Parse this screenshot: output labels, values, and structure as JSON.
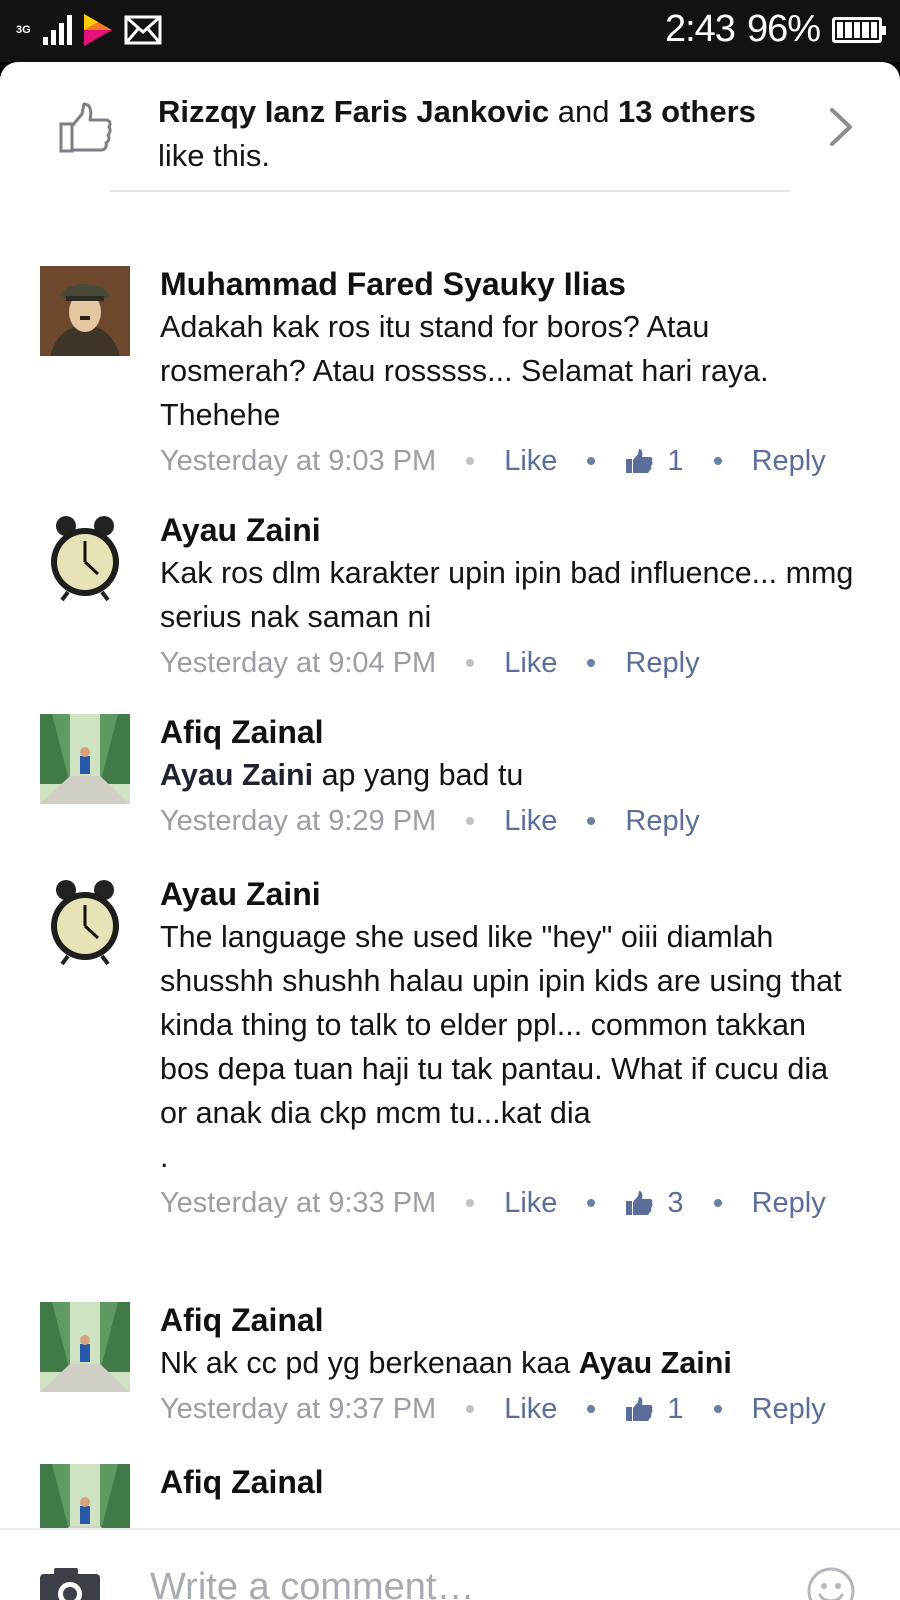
{
  "status_bar": {
    "network": "3G",
    "time": "2:43",
    "battery_percent": "96%"
  },
  "likes_summary": {
    "first_name": "Rizzqy Ianz Faris Jankovic",
    "joiner": " and ",
    "others_count": "13",
    "others_word": "others",
    "suffix": " like this."
  },
  "comments": [
    {
      "author": "Muhammad Fared Syauky Ilias",
      "text": "Adakah kak ros itu stand for boros? Atau rosmerah? Atau rosssss... Selamat hari raya. Thehehe",
      "time": "Yesterday at 9:03 PM",
      "like_label": "Like",
      "like_count": "1",
      "reply_label": "Reply",
      "avatar": "portrait-photo"
    },
    {
      "author": "Ayau Zaini",
      "text": "Kak ros dlm karakter upin ipin bad influence... mmg serius nak saman ni",
      "time": "Yesterday at 9:04 PM",
      "like_label": "Like",
      "reply_label": "Reply",
      "avatar": "alarm-clock-photo"
    },
    {
      "author": "Afiq Zainal",
      "tag": "Ayau Zaini",
      "text": " ap yang bad tu",
      "time": "Yesterday at 9:29 PM",
      "like_label": "Like",
      "reply_label": "Reply",
      "avatar": "forest-path-photo"
    },
    {
      "author": "Ayau Zaini",
      "text": "The language she used like \"hey\" oiii diamlah shusshh shushh halau upin ipin kids are using that kinda thing to talk to elder ppl... common takkan bos depa tuan haji tu tak pantau. What if cucu dia or anak dia ckp mcm tu...kat dia\n.",
      "time": "Yesterday at 9:33 PM",
      "like_label": "Like",
      "like_count": "3",
      "reply_label": "Reply",
      "avatar": "alarm-clock-photo"
    },
    {
      "author": "Afiq Zainal",
      "text": "Nk ak cc pd yg berkenaan kaa ",
      "tag_after": "Ayau Zaini",
      "time": "Yesterday at 9:37 PM",
      "like_label": "Like",
      "like_count": "1",
      "reply_label": "Reply",
      "avatar": "forest-path-photo"
    },
    {
      "author": "Afiq Zainal",
      "avatar": "forest-path-photo"
    }
  ],
  "composer": {
    "placeholder": "Write a comment…",
    "camera_icon": "camera-icon",
    "emoji_icon": "smiley-icon"
  },
  "colors": {
    "link_blue": "#5a6e99",
    "meta_gray": "#9a9ea6",
    "status_bar_bg": "#121212"
  }
}
